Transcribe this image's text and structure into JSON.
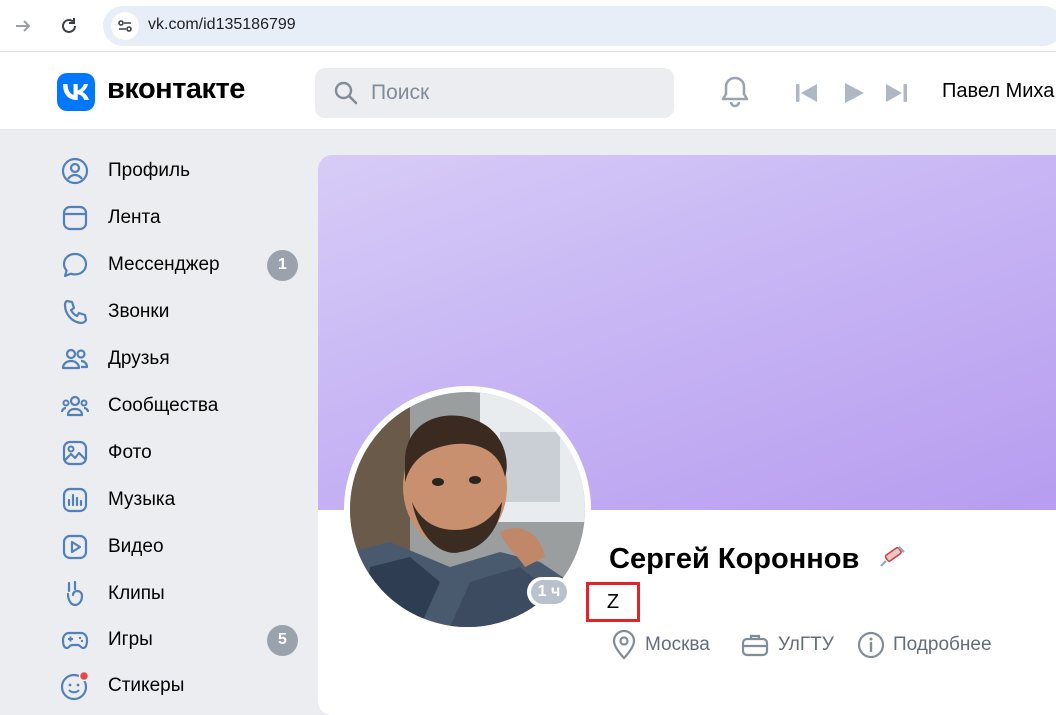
{
  "browser": {
    "url": "vk.com/id135186799"
  },
  "header": {
    "logo_mark": "VK",
    "wordmark": "вконтакте",
    "search_placeholder": "Поиск",
    "user_name": "Павел Миха"
  },
  "sidebar": {
    "items": [
      {
        "label": "Профиль",
        "icon": "user-circle-icon"
      },
      {
        "label": "Лента",
        "icon": "feed-icon"
      },
      {
        "label": "Мессенджер",
        "icon": "message-icon",
        "badge": "1"
      },
      {
        "label": "Звонки",
        "icon": "phone-icon"
      },
      {
        "label": "Друзья",
        "icon": "friends-icon"
      },
      {
        "label": "Сообщества",
        "icon": "communities-icon"
      },
      {
        "label": "Фото",
        "icon": "photo-icon"
      },
      {
        "label": "Музыка",
        "icon": "music-icon"
      },
      {
        "label": "Видео",
        "icon": "video-icon"
      },
      {
        "label": "Клипы",
        "icon": "clips-icon"
      },
      {
        "label": "Игры",
        "icon": "gamepad-icon",
        "badge": "5"
      },
      {
        "label": "Стикеры",
        "icon": "smile-icon"
      }
    ]
  },
  "profile": {
    "name": "Сергей Короннов",
    "status": "Z",
    "online": "1 ч",
    "city": "Москва",
    "work": "УлГТУ",
    "more": "Подробнее"
  },
  "colors": {
    "accent": "#0077ff",
    "badge": "#99a2ad",
    "highlight": "#e2232a"
  }
}
